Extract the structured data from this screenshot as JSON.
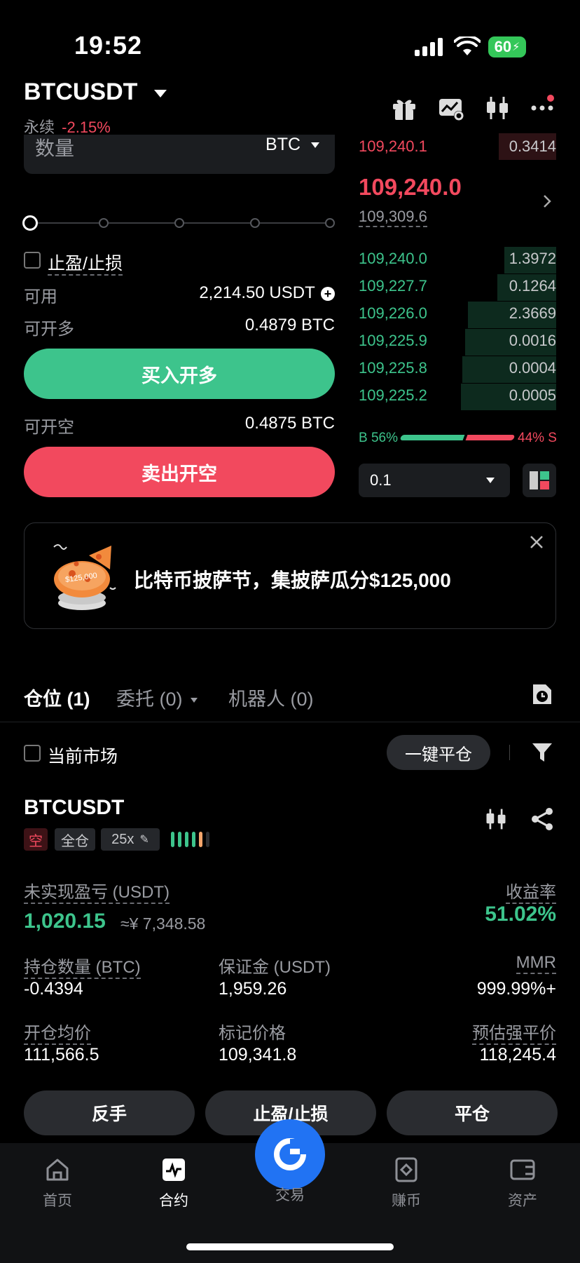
{
  "status_bar": {
    "time": "19:52",
    "battery": "60"
  },
  "header": {
    "symbol": "BTCUSDT",
    "type": "永续",
    "change": "-2.15%"
  },
  "order_form": {
    "qty_label": "数量",
    "qty_unit": "BTC",
    "slider_percent": 0,
    "tpsl_label": "止盈/止损",
    "available_label": "可用",
    "available_value": "2,214.50 USDT",
    "can_long_label": "可开多",
    "can_long_value": "0.4879 BTC",
    "buy_label": "买入开多",
    "can_short_label": "可开空",
    "can_short_value": "0.4875 BTC",
    "sell_label": "卖出开空"
  },
  "order_book": {
    "ask": {
      "price": "109,240.1",
      "qty": "0.3414"
    },
    "last_price": "109,240.0",
    "mark_price": "109,309.6",
    "bids": [
      {
        "price": "109,240.0",
        "qty": "1.3972",
        "depth": 0.4
      },
      {
        "price": "109,227.7",
        "qty": "0.1264",
        "depth": 0.45
      },
      {
        "price": "109,226.0",
        "qty": "2.3669",
        "depth": 0.68
      },
      {
        "price": "109,225.9",
        "qty": "0.0016",
        "depth": 0.7
      },
      {
        "price": "109,225.8",
        "qty": "0.0004",
        "depth": 0.72
      },
      {
        "price": "109,225.2",
        "qty": "0.0005",
        "depth": 0.73
      }
    ],
    "buy_ratio": "B 56%",
    "sell_ratio": "44% S",
    "depth_step": "0.1"
  },
  "promo": {
    "text": "比特币披萨节，集披萨瓜分$125,000",
    "badge": "$125,000"
  },
  "tabs": [
    {
      "label": "仓位 (1)"
    },
    {
      "label": "委托 (0)"
    },
    {
      "label": "机器人 (0)"
    }
  ],
  "filter": {
    "current_market": "当前市场",
    "close_all": "一键平仓"
  },
  "position": {
    "symbol": "BTCUSDT",
    "side": "空",
    "margin_mode": "全仓",
    "leverage": "25x",
    "pnl_label": "未实现盈亏 (USDT)",
    "pnl_value": "1,020.15",
    "pnl_cny": "≈¥ 7,348.58",
    "roe_label": "收益率",
    "roe_value": "51.02%",
    "size_label": "持仓数量 (BTC)",
    "size_value": "-0.4394",
    "margin_label": "保证金 (USDT)",
    "margin_value": "1,959.26",
    "mmr_label": "MMR",
    "mmr_value": "999.99%+",
    "entry_label": "开仓均价",
    "entry_value": "111,566.5",
    "mark_label": "标记价格",
    "mark_value": "109,341.8",
    "liq_label": "预估强平价",
    "liq_value": "118,245.4",
    "actions": {
      "reverse": "反手",
      "tpsl": "止盈/止损",
      "close": "平仓"
    }
  },
  "nav": [
    {
      "label": "首页"
    },
    {
      "label": "合约"
    },
    {
      "label": "交易"
    },
    {
      "label": "赚币"
    },
    {
      "label": "资产"
    }
  ],
  "colors": {
    "green": "#3dc48c",
    "red": "#f2495e",
    "orange": "#f5a66c",
    "fab": "#2173f3"
  }
}
